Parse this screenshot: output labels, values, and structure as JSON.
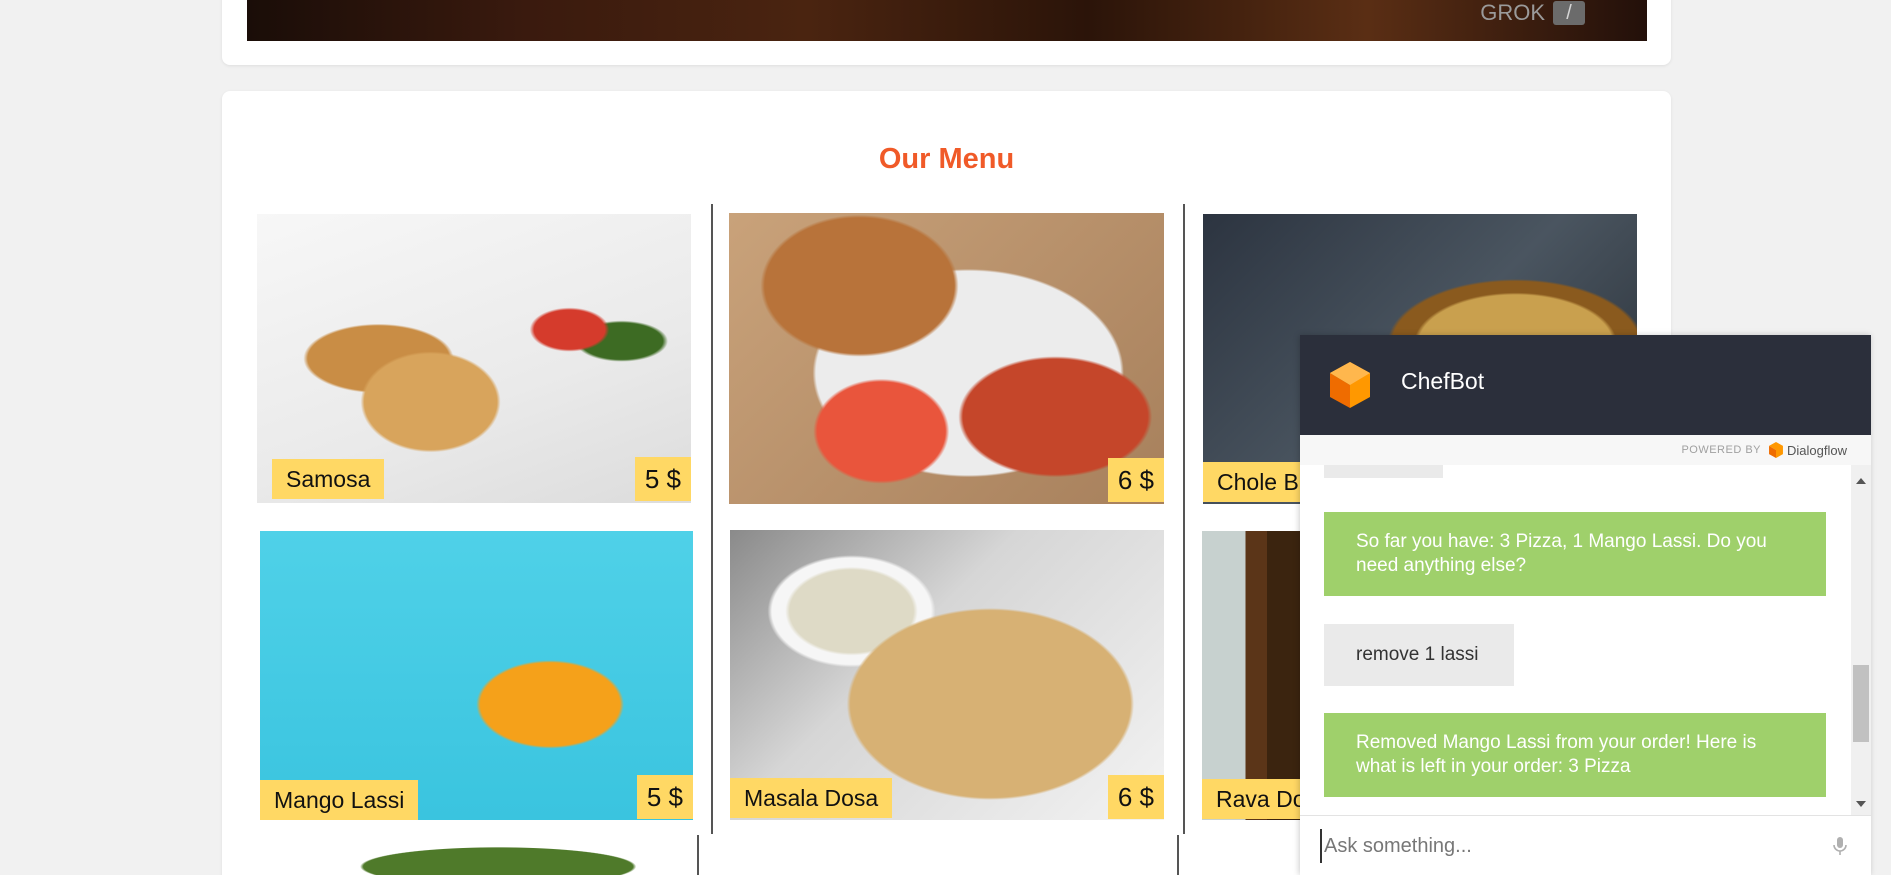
{
  "hero": {
    "brand_text": "GROK",
    "brand_mark": "/"
  },
  "menu": {
    "title": "Our Menu",
    "items": [
      {
        "name": "Samosa",
        "price": "5 $"
      },
      {
        "name": "",
        "price": "6 $"
      },
      {
        "name": "Chole B",
        "price": ""
      },
      {
        "name": "Mango Lassi",
        "price": "5 $"
      },
      {
        "name": "Masala Dosa",
        "price": "6 $"
      },
      {
        "name": "Rava Do",
        "price": ""
      }
    ]
  },
  "chat": {
    "title": "ChefBot",
    "powered_by": "POWERED BY",
    "powered_brand": "Dialogflow",
    "messages": [
      {
        "from": "user",
        "text": ""
      },
      {
        "from": "bot",
        "text": "So far you have: 3 Pizza, 1 Mango Lassi. Do you need anything else?"
      },
      {
        "from": "user",
        "text": "remove 1 lassi"
      },
      {
        "from": "bot",
        "text": "Removed Mango Lassi from your order! Here is what is left in your order: 3 Pizza"
      }
    ],
    "input_placeholder": "Ask something..."
  },
  "icons": {
    "logo": "dialogflow-logo-icon",
    "mic": "microphone-icon"
  },
  "colors": {
    "accent": "#f05a28",
    "label_bg": "#ffd864",
    "bot_bubble": "#9fd06b",
    "chat_header": "#2b2f3b"
  }
}
